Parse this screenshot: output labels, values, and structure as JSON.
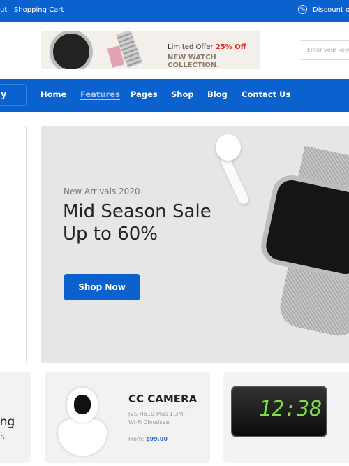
{
  "topbar": {
    "about": "ut",
    "cart": "Shopping Cart",
    "discount": "Discount off"
  },
  "promo": {
    "line1": "Limited Offer",
    "highlight": "25% Off",
    "line2": "NEW WATCH COLLECTION."
  },
  "search": {
    "placeholder": "Enter your keyw"
  },
  "nav": {
    "category": "y",
    "items": [
      "Home",
      "Features",
      "Pages",
      "Shop",
      "Blog",
      "Contact Us"
    ],
    "active": "Features"
  },
  "hero": {
    "subtitle": "New Arrivals 2020",
    "title1": "Mid Season Sale",
    "title2": "Up to 60%",
    "cta": "Shop Now"
  },
  "cards": [
    {
      "title": "ing",
      "link": "ES"
    },
    {
      "title": "CC CAMERA",
      "desc1": "JVS-H510-Plus 1.3MP",
      "desc2": "Wi-Fi Cloudsee.",
      "from": "From:",
      "price": "$99.00"
    },
    {
      "clock": "12:38"
    }
  ],
  "colors": {
    "brand": "#0b62cf",
    "offer": "#e22222"
  }
}
